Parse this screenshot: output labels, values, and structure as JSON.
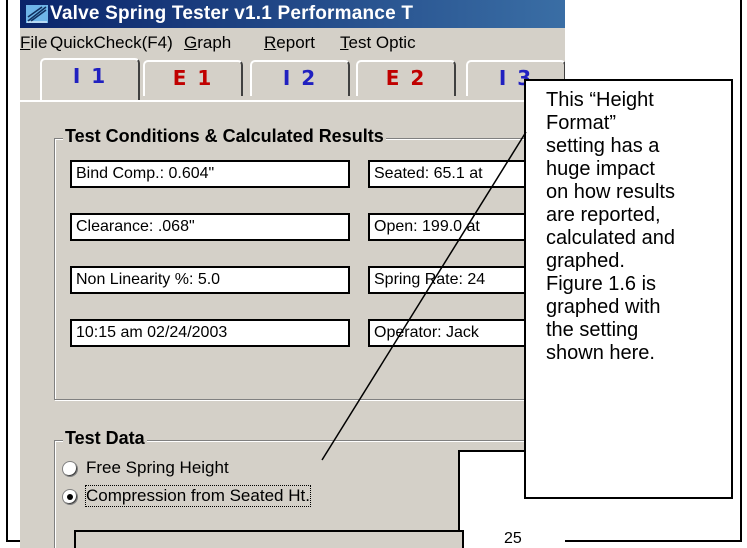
{
  "window": {
    "title": "Valve Spring Tester v1.1   Performance T"
  },
  "menu": {
    "items": [
      {
        "first": "F",
        "rest": "ile"
      },
      {
        "first": "",
        "rest": "QuickCheck(F4)"
      },
      {
        "first": "G",
        "rest": "raph"
      },
      {
        "first": "R",
        "rest": "eport"
      },
      {
        "first": "T",
        "rest": "est Optic"
      }
    ]
  },
  "tabs": [
    {
      "label": "I 1",
      "color": "#2020c0"
    },
    {
      "label": "E 1",
      "color": "#c00000"
    },
    {
      "label": "I 2",
      "color": "#2020c0"
    },
    {
      "label": "E 2",
      "color": "#c00000"
    },
    {
      "label": "I 3",
      "color": "#2020c0"
    }
  ],
  "test_conditions": {
    "title": "Test Conditions & Calculated Results",
    "left": [
      "Bind Comp.: 0.604\"",
      "Clearance: .068\"",
      "Non Linearity %: 5.0",
      "10:15 am  02/24/2003"
    ],
    "right": [
      "Seated: 65.1 at",
      "Open: 199.0 at",
      "Spring Rate: 24",
      "Operator: Jack"
    ]
  },
  "test_data": {
    "title": "Test Data",
    "options": [
      "Free Spring Height",
      "Compression from Seated Ht."
    ],
    "selected_index": 1,
    "chart_tick": "25"
  },
  "callout": {
    "text": "This “Height\nFormat”\nsetting has a\nhuge impact\non how results\nare reported,\ncalculated and\ngraphed.\nFigure 1.6 is\ngraphed with\nthe setting\nshown here."
  }
}
